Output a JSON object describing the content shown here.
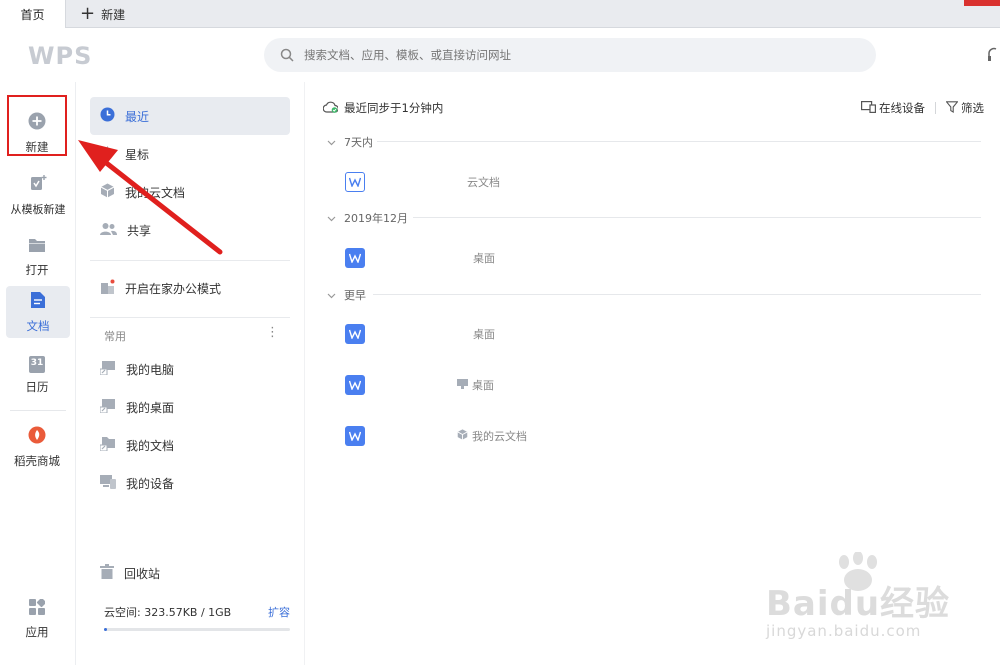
{
  "tabs": {
    "home_label": "首页",
    "new_label": "新建"
  },
  "header": {
    "logo": "WPS",
    "search_placeholder": "搜索文档、应用、模板、或直接访问网址"
  },
  "rail": {
    "items": [
      {
        "label": "新建",
        "icon": "plus-circle-icon"
      },
      {
        "label": "从模板新建",
        "icon": "template-icon"
      },
      {
        "label": "打开",
        "icon": "folder-icon"
      },
      {
        "label": "文档",
        "icon": "document-icon"
      },
      {
        "label": "日历",
        "icon": "calendar-icon"
      },
      {
        "label": "稻壳商城",
        "icon": "docer-icon"
      },
      {
        "label": "应用",
        "icon": "apps-grid-icon"
      }
    ],
    "calendar_day": "31"
  },
  "nav": {
    "items": [
      {
        "label": "最近",
        "icon": "clock-icon"
      },
      {
        "label": "星标",
        "icon": "star-icon"
      },
      {
        "label": "我的云文档",
        "icon": "cloud-cube-icon"
      },
      {
        "label": "共享",
        "icon": "people-icon"
      },
      {
        "label": "开启在家办公模式",
        "icon": "home-office-icon"
      }
    ],
    "section_label": "常用",
    "more_glyph": "⋮",
    "common_items": [
      {
        "label": "我的电脑",
        "icon": "computer-shortcut-icon"
      },
      {
        "label": "我的桌面",
        "icon": "desktop-shortcut-icon"
      },
      {
        "label": "我的文档",
        "icon": "folder-shortcut-icon"
      },
      {
        "label": "我的设备",
        "icon": "devices-icon"
      }
    ],
    "recycle_label": "回收站",
    "quota_text": "云空间: 323.57KB / 1GB",
    "quota_expand": "扩容",
    "quota_fraction": 0.0003
  },
  "main": {
    "sync_text": "最近同步于1分钟内",
    "online_devices": "在线设备",
    "filter": "筛选",
    "groups": [
      {
        "label": "7天内"
      },
      {
        "label": "2019年12月"
      },
      {
        "label": "更早"
      }
    ],
    "files": [
      {
        "location": "云文档"
      },
      {
        "location": "桌面"
      },
      {
        "location": "桌面"
      },
      {
        "location": "桌面"
      },
      {
        "location": "我的云文档"
      }
    ]
  },
  "colors": {
    "accent": "#3b6fd8",
    "highlight": "#e0201e",
    "word_blue": "#4a7ff0"
  },
  "watermark": {
    "brand": "Baidu经验",
    "url": "jingyan.baidu.com"
  }
}
